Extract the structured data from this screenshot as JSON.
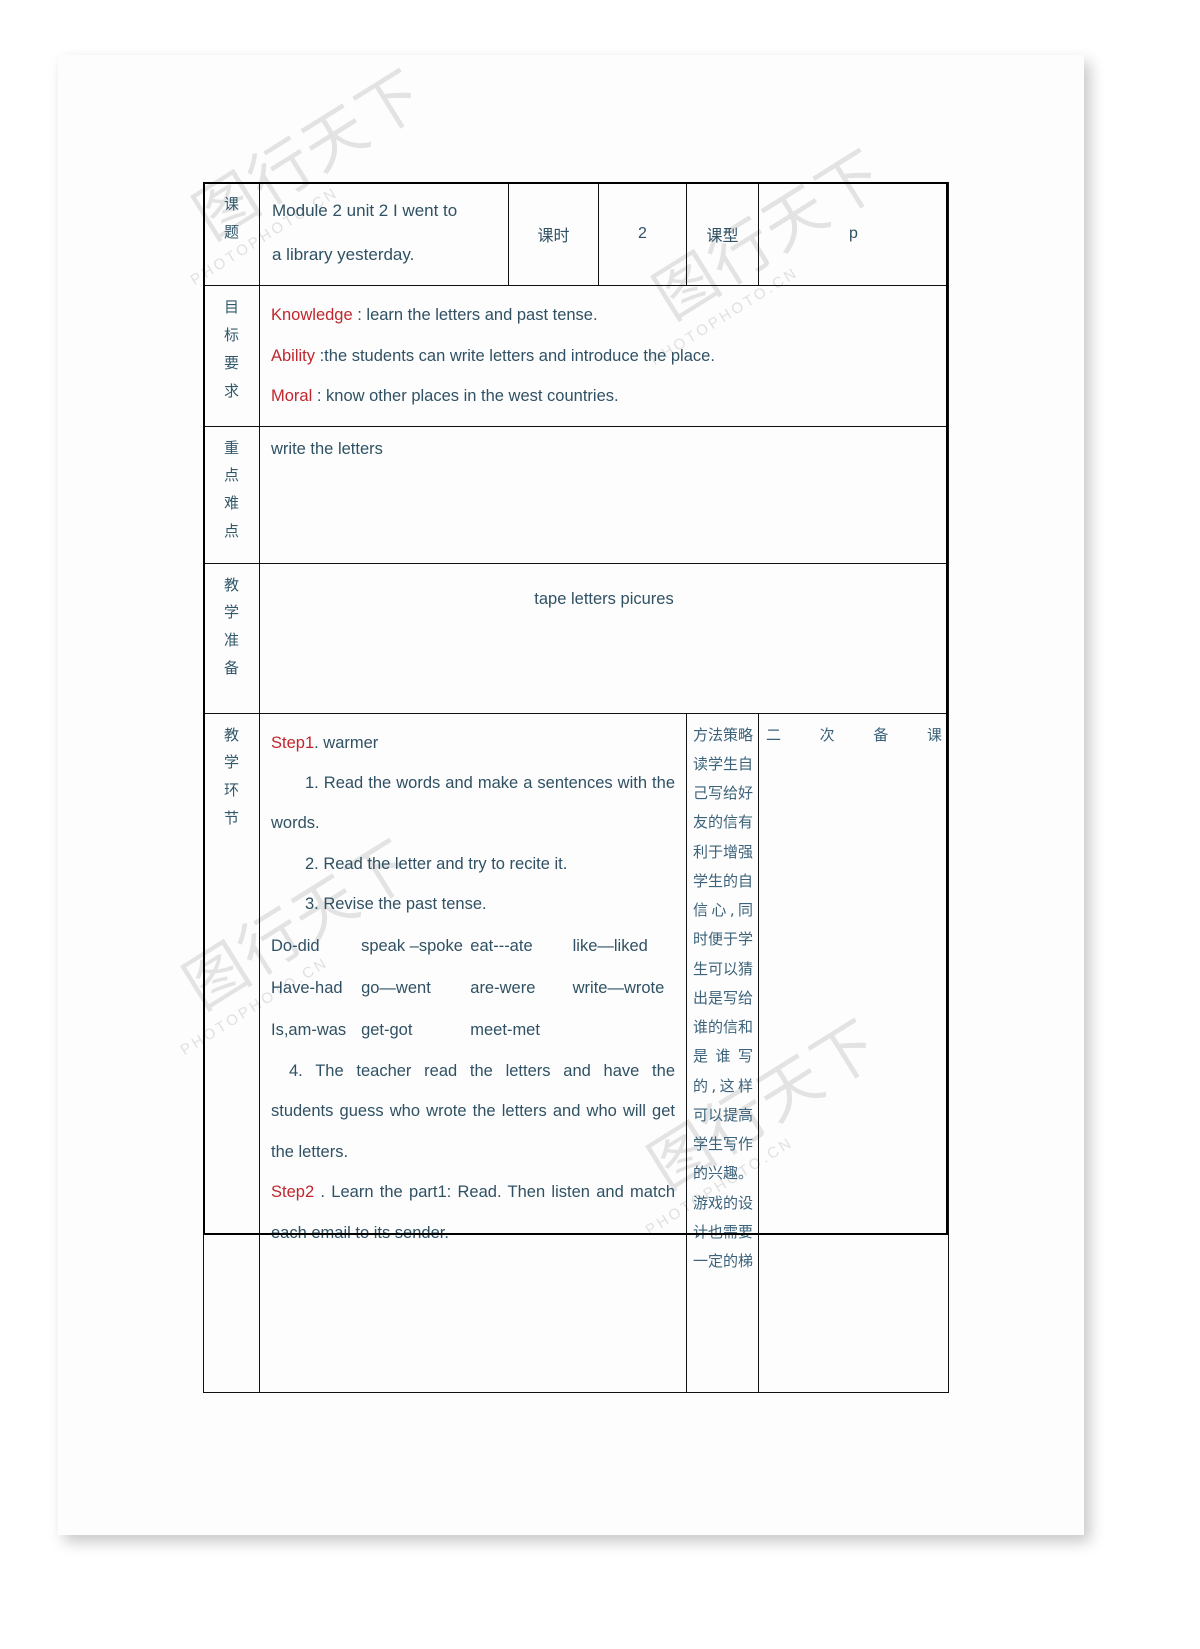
{
  "document": {
    "type": "lesson-plan-table",
    "text_color": "#2f5163",
    "accent_color": "#c0272d",
    "watermark": "图行天下 PHOTOPHOTO.CN"
  },
  "table": {
    "row_title": {
      "label": "课题",
      "title_line1": "Module 2 unit 2   I went to",
      "title_line2": "a library yesterday.",
      "periods_label": "课时",
      "periods_value": "2",
      "type_label": "课型",
      "type_value": "p"
    },
    "row_objectives": {
      "label": "目标要求",
      "items": [
        {
          "tag": "Knowledge",
          "text": " : learn the letters and past tense."
        },
        {
          "tag": "Ability",
          "text": " :the students can write letters and introduce the place."
        },
        {
          "tag": "Moral",
          "text": " : know other places in the west countries."
        }
      ]
    },
    "row_key_points": {
      "label": "重点难点",
      "text": "write the letters"
    },
    "row_preparation": {
      "label": "教学准备",
      "text": "tape letters   picures"
    },
    "row_procedure": {
      "label": "教学环节",
      "step1_tag": "Step1",
      "step1_text": ". warmer",
      "item1": "1. Read the words and make a sentences with the words.",
      "item2": "2. Read the letter and try to recite it.",
      "item3": "3. Revise the past tense.",
      "verbs": [
        [
          "Do-did",
          "speak –spoke",
          "eat---ate",
          "like—liked"
        ],
        [
          "Have-had",
          "go—went",
          "are-were",
          "write—wrote"
        ],
        [
          "Is,am-was",
          "get-got",
          "meet-met",
          ""
        ]
      ],
      "item4": "4.  The teacher   read the letters and have the students guess who wrote the letters and who will get the letters.",
      "step2_tag": "Step2",
      "step2_text": " . Learn the part1: Read. Then listen and match each email to its sender.",
      "methods_column": "方法策略 读学生自己写给好友的信有利于增强学生的自信心,同时便于学生可以猜出是写给谁的信和是谁写的,这样可以提高学生写作的兴趣。游戏的设计也需要一定的梯",
      "second_prep_column": "二次备课"
    }
  }
}
